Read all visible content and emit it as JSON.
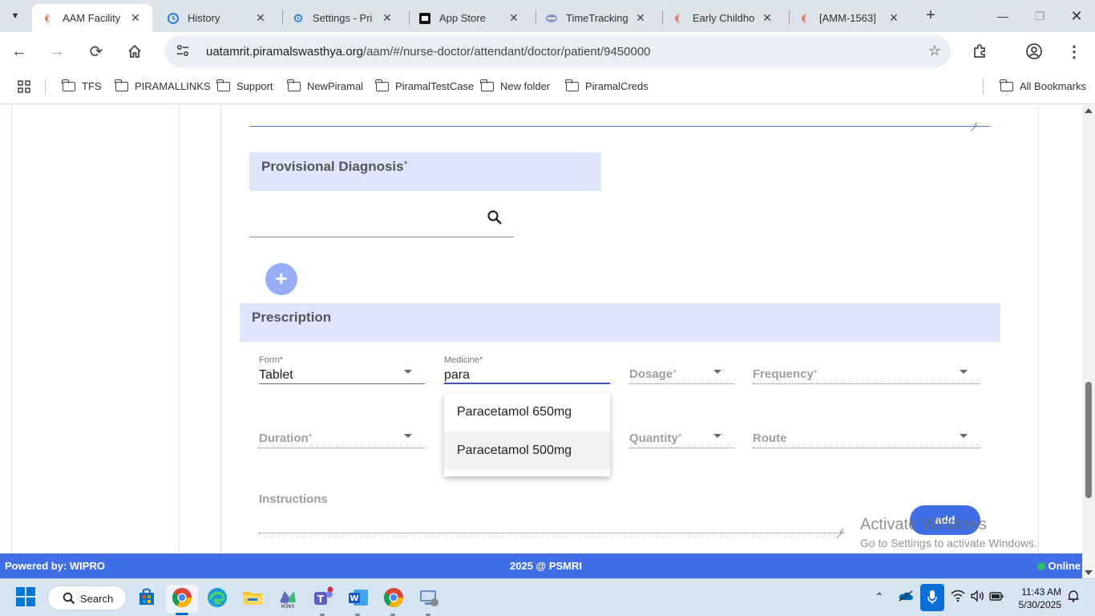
{
  "browser": {
    "tabs": [
      {
        "title": "AAM Facility",
        "active": true,
        "icon": "piramal-logo-icon"
      },
      {
        "title": "History",
        "active": false,
        "icon": "history-icon"
      },
      {
        "title": "Settings - Pri",
        "active": false,
        "icon": "gear-icon"
      },
      {
        "title": "App Store",
        "active": false,
        "icon": "app-store-icon"
      },
      {
        "title": "TimeTracking",
        "active": false,
        "icon": "timetracking-icon"
      },
      {
        "title": "Early Childho",
        "active": false,
        "icon": "piramal-logo-icon"
      },
      {
        "title": "[AMM-1563]",
        "active": false,
        "icon": "piramal-logo-icon"
      }
    ],
    "url_host": "uatamrit.piramalswasthya.org",
    "url_path": "/aam/#/nurse-doctor/attendant/doctor/patient/9450000",
    "bookmarks": [
      "TFS",
      "PIRAMALLINKS",
      "Support",
      "NewPiramal",
      "PiramalTestCase",
      "New folder",
      "PiramalCreds"
    ],
    "all_bookmarks": "All Bookmarks"
  },
  "page": {
    "diagnosis": {
      "title": "Provisional Diagnosis",
      "required_mark": "*",
      "search_value": ""
    },
    "prescription": {
      "title": "Prescription",
      "form": {
        "label": "Form",
        "required_mark": "*",
        "value": "Tablet"
      },
      "medicine": {
        "label": "Medicine",
        "required_mark": "*",
        "value": "para"
      },
      "dosage": {
        "placeholder": "Dosage",
        "required_mark": "*"
      },
      "frequency": {
        "placeholder": "Frequency",
        "required_mark": "*"
      },
      "duration": {
        "placeholder": "Duration",
        "required_mark": "*"
      },
      "quantity": {
        "placeholder": "Quantity",
        "required_mark": "*"
      },
      "route": {
        "placeholder": "Route"
      },
      "instructions": {
        "placeholder": "Instructions"
      },
      "add_label": "add"
    },
    "medicine_suggestions": [
      "Paracetamol 650mg",
      "Paracetamol 500mg"
    ]
  },
  "footer": {
    "powered_by": "Powered by: WIPRO",
    "copyright": "2025 @ PSMRI",
    "status": "Online",
    "status_color": "#26c26b"
  },
  "watermark": {
    "line1": "Activate Windows",
    "line2": "Go to Settings to activate Windows."
  },
  "taskbar": {
    "search_label": "Search",
    "time": "11:43 AM",
    "date": "5/30/2025"
  },
  "colors": {
    "accent": "#3f6ee7",
    "section_bg": "#dde6fc",
    "fab": "#97aef6"
  }
}
